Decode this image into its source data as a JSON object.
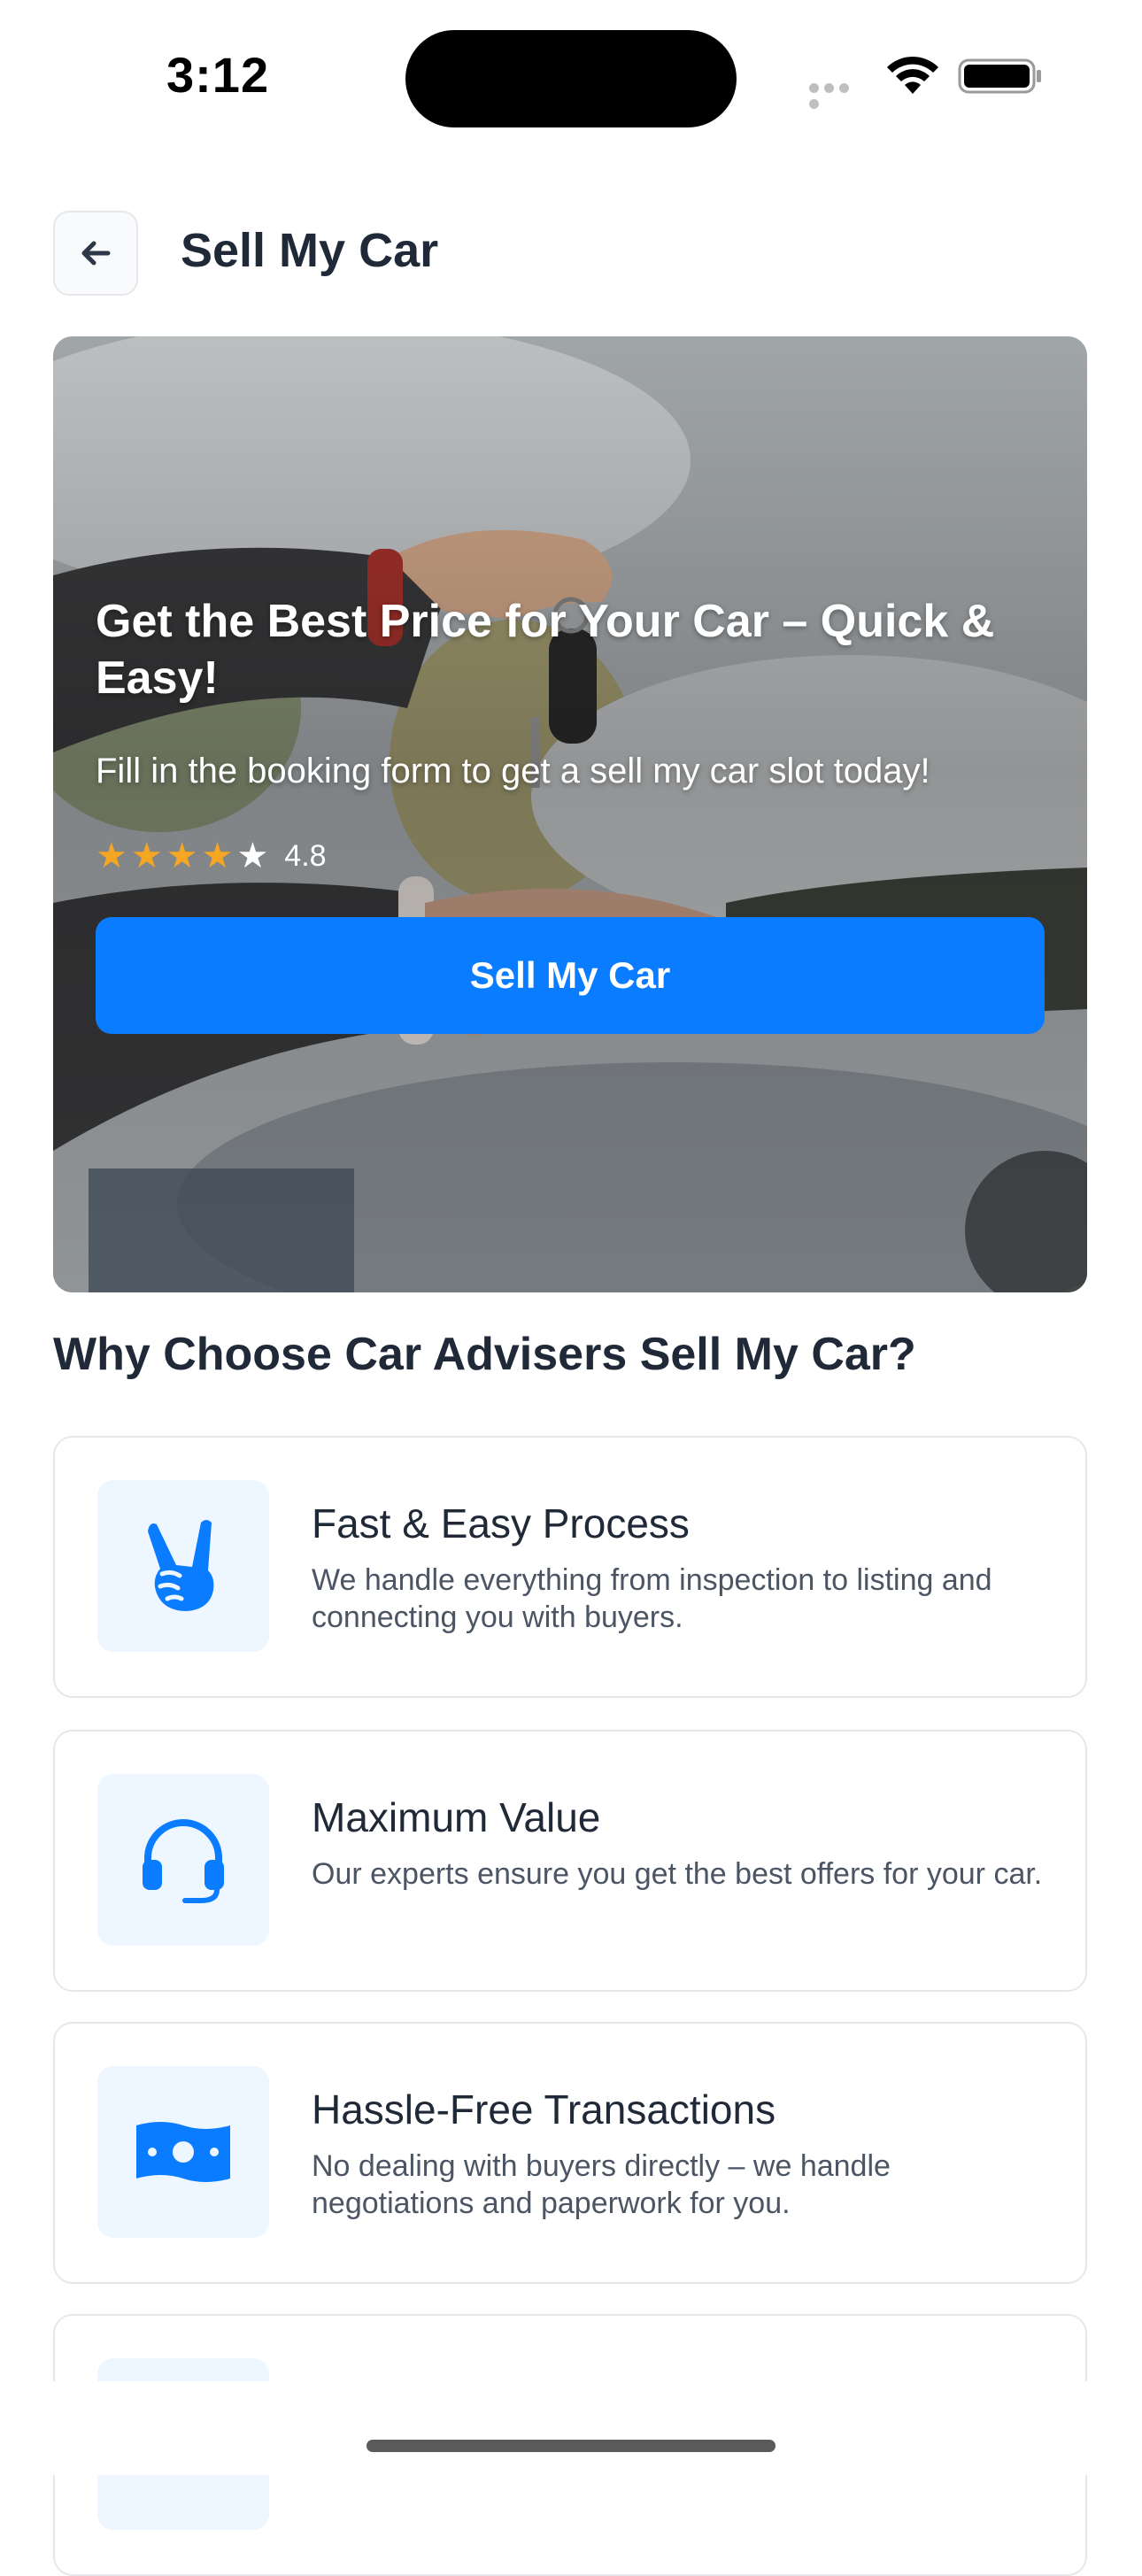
{
  "status_bar": {
    "time": "3:12"
  },
  "header": {
    "back_icon": "arrow-left-icon",
    "title": "Sell My Car"
  },
  "hero": {
    "title": "Get the Best Price for Your Car – Quick & Easy!",
    "subtitle": "Fill in the booking form to get a sell my car slot today!",
    "rating": {
      "stars_filled": 4,
      "stars_total": 5,
      "value": "4.8"
    },
    "cta_label": "Sell My Car"
  },
  "why": {
    "title": "Why Choose Car Advisers Sell My Car?",
    "features": [
      {
        "icon": "hand-peace-icon",
        "title": "Fast & Easy Process",
        "description": "We handle everything from inspection to listing and connecting you with buyers."
      },
      {
        "icon": "headset-icon",
        "title": "Maximum Value",
        "description": "Our experts ensure you get the best offers for your car."
      },
      {
        "icon": "money-bill-icon",
        "title": "Hassle-Free Transactions",
        "description": "No dealing with buyers directly – we handle negotiations and paperwork for you."
      }
    ]
  },
  "colors": {
    "accent": "#0a7cff",
    "icon_bg": "#eef6ff",
    "star": "#f5a623",
    "title_text": "#1f2937",
    "body_text": "#4b5563"
  }
}
